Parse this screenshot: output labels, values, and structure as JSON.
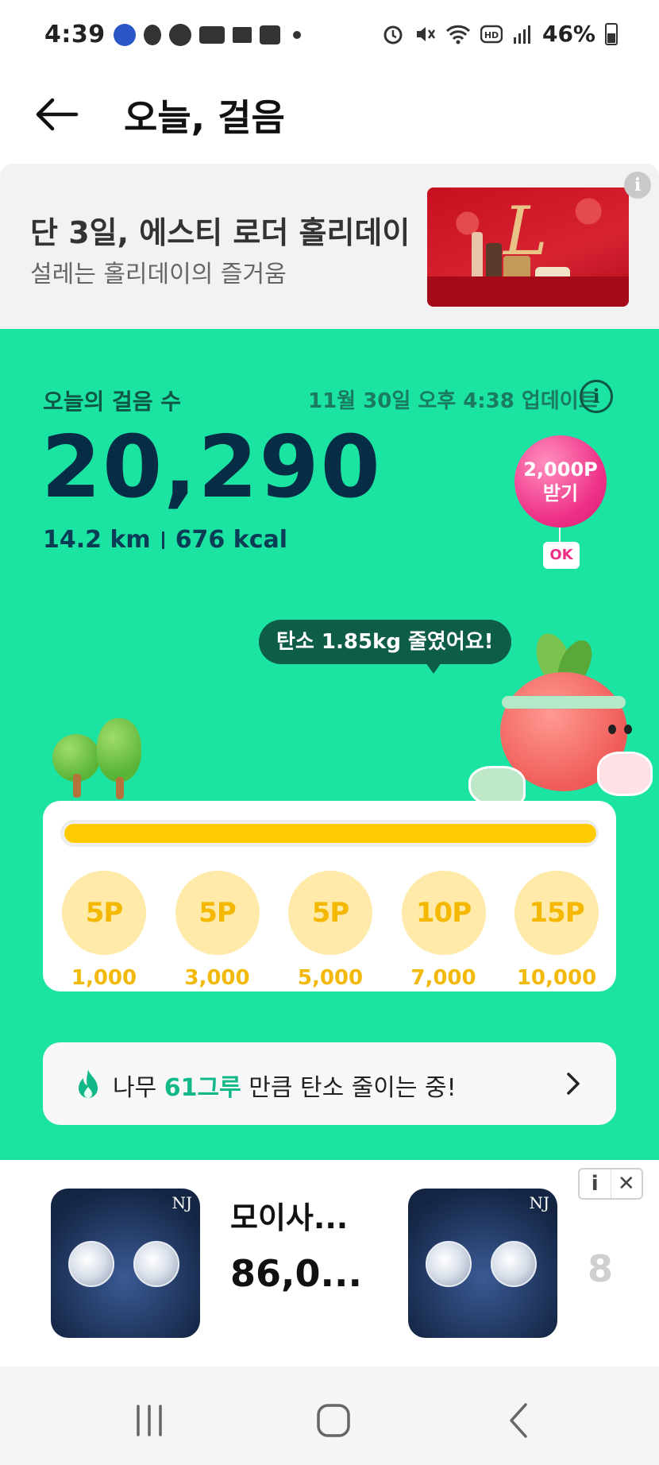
{
  "status_bar": {
    "time": "4:39",
    "battery": "46%",
    "left_icons": [
      "app-icon",
      "app-icon",
      "speedometer-icon",
      "cash-icon",
      "stairs-icon",
      "image-icon",
      "dot-icon"
    ],
    "right_icons": [
      "alarm-icon",
      "mute-icon",
      "wifi-icon",
      "hd-icon",
      "signal-icon",
      "battery-icon"
    ]
  },
  "header": {
    "title": "오늘, 걸음"
  },
  "banner_ad": {
    "title": "단 3일, 에스티 로더 홀리데이",
    "subtitle": "설레는 홀리데이의 즐거움",
    "info_glyph": "i"
  },
  "steps": {
    "label": "오늘의 걸음 수",
    "updated": "11월 30일 오후 4:38 업데이트",
    "info_glyph": "i",
    "count": "20,290",
    "distance": "14.2 km",
    "calories": "676 kcal",
    "reward_line1": "2,000P",
    "reward_line2": "받기",
    "reward_badge": "OK",
    "carbon_bubble": "탄소 1.85kg 줄였어요!"
  },
  "progress": {
    "fill_fraction": 1.0,
    "accent": "#ffcb00",
    "milestones": [
      {
        "points": "5P",
        "steps": "1,000"
      },
      {
        "points": "5P",
        "steps": "3,000"
      },
      {
        "points": "5P",
        "steps": "5,000"
      },
      {
        "points": "10P",
        "steps": "7,000"
      },
      {
        "points": "15P",
        "steps": "10,000"
      }
    ]
  },
  "carbon": {
    "prefix": "나무 ",
    "highlight": "61그루",
    "suffix": " 만큼 탄소 줄이는 중!"
  },
  "product_ad": {
    "name": "모이사...",
    "price": "86,0...",
    "peek": "8",
    "brand_mark": "NJ",
    "info_glyph": "i",
    "close_glyph": "✕"
  },
  "colors": {
    "green_bg": "#1be3a2",
    "dark_text": "#072c45",
    "highlight": "#12b888",
    "reward_pink": "#ee2f86"
  }
}
